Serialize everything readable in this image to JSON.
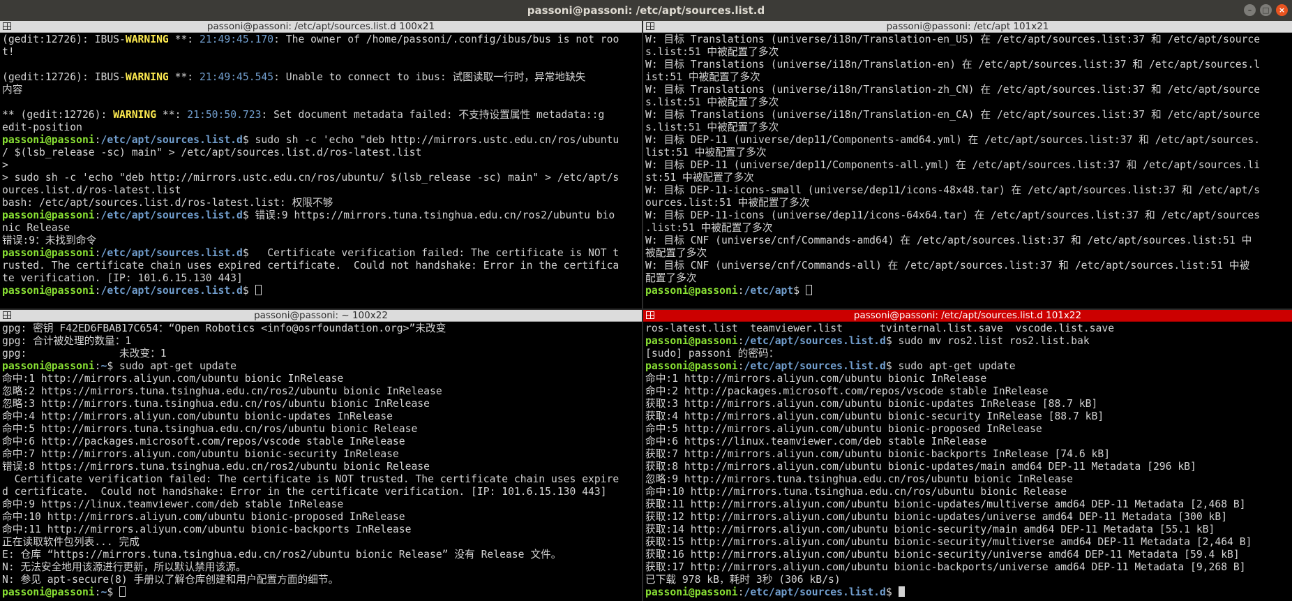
{
  "window": {
    "title": "passoni@passoni: /etc/apt/sources.list.d"
  },
  "panes": {
    "tl": {
      "title": "passoni@passoni: /etc/apt/sources.list.d 100x21",
      "lines": [
        [
          [
            "",
            "(gedit:12726): IBUS-"
          ],
          [
            "w",
            "WARNING"
          ],
          [
            "",
            " **: "
          ],
          [
            "t",
            "21:49:45.170"
          ],
          [
            "",
            ": The owner of /home/passoni/.config/ibus/bus is not roo"
          ]
        ],
        [
          [
            "",
            "t!"
          ]
        ],
        [
          [
            "",
            ""
          ]
        ],
        [
          [
            "",
            "(gedit:12726): IBUS-"
          ],
          [
            "w",
            "WARNING"
          ],
          [
            "",
            " **: "
          ],
          [
            "t",
            "21:49:45.545"
          ],
          [
            "",
            ": Unable to connect to ibus: 试图读取一行时，异常地缺失"
          ]
        ],
        [
          [
            "",
            "内容"
          ]
        ],
        [
          [
            "",
            ""
          ]
        ],
        [
          [
            "",
            "** (gedit:12726): "
          ],
          [
            "w",
            "WARNING"
          ],
          [
            "",
            " **: "
          ],
          [
            "t",
            "21:50:50.723"
          ],
          [
            "",
            ": Set document metadata failed: 不支持设置属性 metadata::g"
          ]
        ],
        [
          [
            "",
            "edit-position"
          ]
        ],
        [
          [
            "u",
            "passoni@passoni"
          ],
          [
            "",
            ":"
          ],
          [
            "p",
            "/etc/apt/sources.list.d"
          ],
          [
            "",
            "$ sudo sh -c 'echo \"deb http://mirrors.ustc.edu.cn/ros/ubuntu"
          ]
        ],
        [
          [
            "",
            "/ $(lsb_release -sc) main\" > /etc/apt/sources.list.d/ros-latest.list"
          ]
        ],
        [
          [
            "",
            ">"
          ]
        ],
        [
          [
            "",
            "> sudo sh -c 'echo \"deb http://mirrors.ustc.edu.cn/ros/ubuntu/ $(lsb_release -sc) main\" > /etc/apt/s"
          ]
        ],
        [
          [
            "",
            "ources.list.d/ros-latest.list"
          ]
        ],
        [
          [
            "",
            "bash: /etc/apt/sources.list.d/ros-latest.list: 权限不够"
          ]
        ],
        [
          [
            "u",
            "passoni@passoni"
          ],
          [
            "",
            ":"
          ],
          [
            "p",
            "/etc/apt/sources.list.d"
          ],
          [
            "",
            "$ 错误:9 https://mirrors.tuna.tsinghua.edu.cn/ros2/ubuntu bio"
          ]
        ],
        [
          [
            "",
            "nic Release"
          ]
        ],
        [
          [
            "",
            "错误:9：未找到命令"
          ]
        ],
        [
          [
            "u",
            "passoni@passoni"
          ],
          [
            "",
            ":"
          ],
          [
            "p",
            "/etc/apt/sources.list.d"
          ],
          [
            "",
            "$   Certificate verification failed: The certificate is NOT t"
          ]
        ],
        [
          [
            "",
            "rusted. The certificate chain uses expired certificate.  Could not handshake: Error in the certifica"
          ]
        ],
        [
          [
            "",
            "te verification. [IP: 101.6.15.130 443]"
          ]
        ],
        [
          [
            "u",
            "passoni@passoni"
          ],
          [
            "",
            ":"
          ],
          [
            "p",
            "/etc/apt/sources.list.d"
          ],
          [
            "",
            "$ "
          ],
          [
            "cur",
            ""
          ]
        ]
      ]
    },
    "tr": {
      "title": "passoni@passoni: /etc/apt 101x21",
      "lines": [
        [
          [
            "",
            "W: 目标 Translations (universe/i18n/Translation-en_US) 在 /etc/apt/sources.list:37 和 /etc/apt/source"
          ]
        ],
        [
          [
            "",
            "s.list:51 中被配置了多次"
          ]
        ],
        [
          [
            "",
            "W: 目标 Translations (universe/i18n/Translation-en) 在 /etc/apt/sources.list:37 和 /etc/apt/sources.l"
          ]
        ],
        [
          [
            "",
            "ist:51 中被配置了多次"
          ]
        ],
        [
          [
            "",
            "W: 目标 Translations (universe/i18n/Translation-zh_CN) 在 /etc/apt/sources.list:37 和 /etc/apt/source"
          ]
        ],
        [
          [
            "",
            "s.list:51 中被配置了多次"
          ]
        ],
        [
          [
            "",
            "W: 目标 Translations (universe/i18n/Translation-en_CA) 在 /etc/apt/sources.list:37 和 /etc/apt/source"
          ]
        ],
        [
          [
            "",
            "s.list:51 中被配置了多次"
          ]
        ],
        [
          [
            "",
            "W: 目标 DEP-11 (universe/dep11/Components-amd64.yml) 在 /etc/apt/sources.list:37 和 /etc/apt/sources."
          ]
        ],
        [
          [
            "",
            "list:51 中被配置了多次"
          ]
        ],
        [
          [
            "",
            "W: 目标 DEP-11 (universe/dep11/Components-all.yml) 在 /etc/apt/sources.list:37 和 /etc/apt/sources.li"
          ]
        ],
        [
          [
            "",
            "st:51 中被配置了多次"
          ]
        ],
        [
          [
            "",
            "W: 目标 DEP-11-icons-small (universe/dep11/icons-48x48.tar) 在 /etc/apt/sources.list:37 和 /etc/apt/s"
          ]
        ],
        [
          [
            "",
            "ources.list:51 中被配置了多次"
          ]
        ],
        [
          [
            "",
            "W: 目标 DEP-11-icons (universe/dep11/icons-64x64.tar) 在 /etc/apt/sources.list:37 和 /etc/apt/sources"
          ]
        ],
        [
          [
            "",
            ".list:51 中被配置了多次"
          ]
        ],
        [
          [
            "",
            "W: 目标 CNF (universe/cnf/Commands-amd64) 在 /etc/apt/sources.list:37 和 /etc/apt/sources.list:51 中"
          ]
        ],
        [
          [
            "",
            "被配置了多次"
          ]
        ],
        [
          [
            "",
            "W: 目标 CNF (universe/cnf/Commands-all) 在 /etc/apt/sources.list:37 和 /etc/apt/sources.list:51 中被"
          ]
        ],
        [
          [
            "",
            "配置了多次"
          ]
        ],
        [
          [
            "u",
            "passoni@passoni"
          ],
          [
            "",
            ":"
          ],
          [
            "p",
            "/etc/apt"
          ],
          [
            "",
            "$ "
          ],
          [
            "cur",
            ""
          ]
        ]
      ]
    },
    "bl": {
      "title": "passoni@passoni: ~ 100x22",
      "lines": [
        [
          [
            "",
            "gpg: 密钥 F42ED6FBAB17C654：“Open Robotics <info@osrfoundation.org>”未改变"
          ]
        ],
        [
          [
            "",
            "gpg: 合计被处理的数量：1"
          ]
        ],
        [
          [
            "",
            "gpg:               未改变：1"
          ]
        ],
        [
          [
            "u",
            "passoni@passoni"
          ],
          [
            "",
            ":"
          ],
          [
            "p",
            "~"
          ],
          [
            "",
            "$ sudo apt-get update"
          ]
        ],
        [
          [
            "",
            "命中:1 http://mirrors.aliyun.com/ubuntu bionic InRelease"
          ]
        ],
        [
          [
            "",
            "忽略:2 https://mirrors.tuna.tsinghua.edu.cn/ros2/ubuntu bionic InRelease"
          ]
        ],
        [
          [
            "",
            "忽略:3 http://mirrors.tuna.tsinghua.edu.cn/ros/ubuntu bionic InRelease"
          ]
        ],
        [
          [
            "",
            "命中:4 http://mirrors.aliyun.com/ubuntu bionic-updates InRelease"
          ]
        ],
        [
          [
            "",
            "命中:5 http://mirrors.tuna.tsinghua.edu.cn/ros/ubuntu bionic Release"
          ]
        ],
        [
          [
            "",
            "命中:6 http://packages.microsoft.com/repos/vscode stable InRelease"
          ]
        ],
        [
          [
            "",
            "命中:7 http://mirrors.aliyun.com/ubuntu bionic-security InRelease"
          ]
        ],
        [
          [
            "",
            "错误:8 https://mirrors.tuna.tsinghua.edu.cn/ros2/ubuntu bionic Release"
          ]
        ],
        [
          [
            "",
            "  Certificate verification failed: The certificate is NOT trusted. The certificate chain uses expire"
          ]
        ],
        [
          [
            "",
            "d certificate.  Could not handshake: Error in the certificate verification. [IP: 101.6.15.130 443]"
          ]
        ],
        [
          [
            "",
            "命中:9 https://linux.teamviewer.com/deb stable InRelease"
          ]
        ],
        [
          [
            "",
            "命中:10 http://mirrors.aliyun.com/ubuntu bionic-proposed InRelease"
          ]
        ],
        [
          [
            "",
            "命中:11 http://mirrors.aliyun.com/ubuntu bionic-backports InRelease"
          ]
        ],
        [
          [
            "",
            "正在读取软件包列表... 完成"
          ]
        ],
        [
          [
            "",
            "E: 仓库 “https://mirrors.tuna.tsinghua.edu.cn/ros2/ubuntu bionic Release” 没有 Release 文件。"
          ]
        ],
        [
          [
            "",
            "N: 无法安全地用该源进行更新，所以默认禁用该源。"
          ]
        ],
        [
          [
            "",
            "N: 参见 apt-secure(8) 手册以了解仓库创建和用户配置方面的细节。"
          ]
        ],
        [
          [
            "u",
            "passoni@passoni"
          ],
          [
            "",
            ":"
          ],
          [
            "p",
            "~"
          ],
          [
            "",
            "$ "
          ],
          [
            "cur",
            ""
          ]
        ]
      ]
    },
    "br": {
      "title": "passoni@passoni: /etc/apt/sources.list.d 101x22",
      "lines": [
        [
          [
            "",
            "ros-latest.list  teamviewer.list      tvinternal.list.save  vscode.list.save"
          ]
        ],
        [
          [
            "u",
            "passoni@passoni"
          ],
          [
            "",
            ":"
          ],
          [
            "p",
            "/etc/apt/sources.list.d"
          ],
          [
            "",
            "$ sudo mv ros2.list ros2.list.bak"
          ]
        ],
        [
          [
            "",
            "[sudo] passoni 的密码："
          ]
        ],
        [
          [
            "u",
            "passoni@passoni"
          ],
          [
            "",
            ":"
          ],
          [
            "p",
            "/etc/apt/sources.list.d"
          ],
          [
            "",
            "$ sudo apt-get update"
          ]
        ],
        [
          [
            "",
            "命中:1 http://mirrors.aliyun.com/ubuntu bionic InRelease"
          ]
        ],
        [
          [
            "",
            "命中:2 http://packages.microsoft.com/repos/vscode stable InRelease"
          ]
        ],
        [
          [
            "",
            "获取:3 http://mirrors.aliyun.com/ubuntu bionic-updates InRelease [88.7 kB]"
          ]
        ],
        [
          [
            "",
            "获取:4 http://mirrors.aliyun.com/ubuntu bionic-security InRelease [88.7 kB]"
          ]
        ],
        [
          [
            "",
            "命中:5 http://mirrors.aliyun.com/ubuntu bionic-proposed InRelease"
          ]
        ],
        [
          [
            "",
            "命中:6 https://linux.teamviewer.com/deb stable InRelease"
          ]
        ],
        [
          [
            "",
            "获取:7 http://mirrors.aliyun.com/ubuntu bionic-backports InRelease [74.6 kB]"
          ]
        ],
        [
          [
            "",
            "获取:8 http://mirrors.aliyun.com/ubuntu bionic-updates/main amd64 DEP-11 Metadata [296 kB]"
          ]
        ],
        [
          [
            "",
            "忽略:9 http://mirrors.tuna.tsinghua.edu.cn/ros/ubuntu bionic InRelease"
          ]
        ],
        [
          [
            "",
            "命中:10 http://mirrors.tuna.tsinghua.edu.cn/ros/ubuntu bionic Release"
          ]
        ],
        [
          [
            "",
            "获取:11 http://mirrors.aliyun.com/ubuntu bionic-updates/multiverse amd64 DEP-11 Metadata [2,468 B]"
          ]
        ],
        [
          [
            "",
            "获取:12 http://mirrors.aliyun.com/ubuntu bionic-updates/universe amd64 DEP-11 Metadata [300 kB]"
          ]
        ],
        [
          [
            "",
            "获取:14 http://mirrors.aliyun.com/ubuntu bionic-security/main amd64 DEP-11 Metadata [55.1 kB]"
          ]
        ],
        [
          [
            "",
            "获取:15 http://mirrors.aliyun.com/ubuntu bionic-security/multiverse amd64 DEP-11 Metadata [2,464 B]"
          ]
        ],
        [
          [
            "",
            "获取:16 http://mirrors.aliyun.com/ubuntu bionic-security/universe amd64 DEP-11 Metadata [59.4 kB]"
          ]
        ],
        [
          [
            "",
            "获取:17 http://mirrors.aliyun.com/ubuntu bionic-backports/universe amd64 DEP-11 Metadata [9,268 B]"
          ]
        ],
        [
          [
            "",
            "已下载 978 kB，耗时 3秒 (306 kB/s)"
          ]
        ],
        [
          [
            "u",
            "passoni@passoni"
          ],
          [
            "",
            ":"
          ],
          [
            "p",
            "/etc/apt/sources.list.d"
          ],
          [
            "",
            "$ "
          ],
          [
            "cursolid",
            ""
          ]
        ]
      ]
    }
  }
}
